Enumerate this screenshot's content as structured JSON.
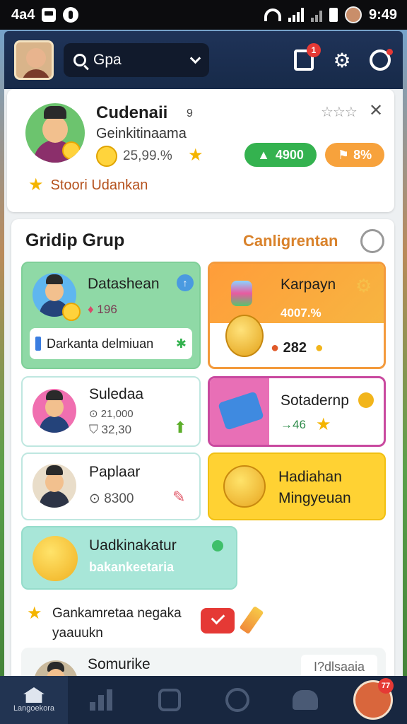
{
  "status_bar": {
    "left_text": "4a4",
    "time": "9:49"
  },
  "header": {
    "search": {
      "value": "Gpa"
    },
    "notification_count": "1"
  },
  "profile": {
    "name": "Cudenaii",
    "name_suffix": "9",
    "subtitle": "Geinkitinaama",
    "stat": "25,99.%",
    "rating_stars": "☆☆☆",
    "green_pill": "4900",
    "orange_pill": "8%",
    "promo_text": "Stoori Udankan"
  },
  "group": {
    "title": "Gridip Grup",
    "link_label": "Canligrentan",
    "tiles": {
      "datashean": {
        "title": "Datashean",
        "stat": "196",
        "field_text": "Darkanta delmiuan"
      },
      "karpayn": {
        "title": "Karpayn",
        "percent": "4007.%",
        "coins": "282"
      },
      "suledaa": {
        "title": "Suledaa",
        "stat1": "21,000",
        "stat2": "32,30"
      },
      "sotadernp": {
        "title": "Sotadernp",
        "stat": "→46"
      },
      "paplaar": {
        "title": "Paplaar",
        "stat": "8300"
      },
      "hadiahan": {
        "line1": "Hadiahan",
        "line2": "Mingyeuan"
      },
      "uadkinakatur": {
        "title": "Uadkinakatur",
        "subtitle": "bakankeetaria"
      }
    },
    "reminder": {
      "line1": "Gankamretaa negaka",
      "line2": "yaauukn"
    },
    "partial": {
      "label": "Somurike",
      "button": "I?dlsaaia"
    }
  },
  "bottom_nav": {
    "home_label": "Langoekora",
    "avatar_badge": "77"
  }
}
